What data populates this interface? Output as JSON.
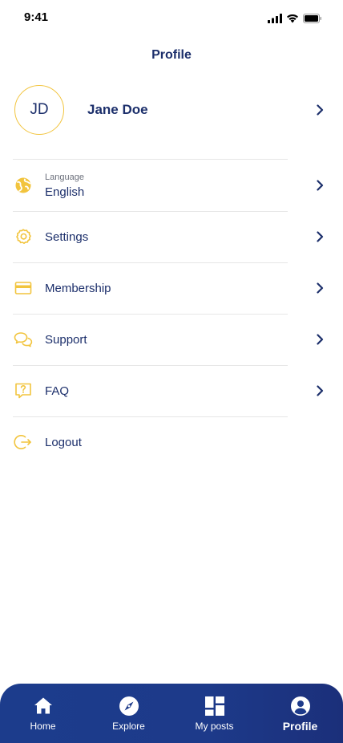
{
  "status_bar": {
    "time": "9:41",
    "icons": [
      "signal-icon",
      "wifi-icon",
      "battery-icon"
    ]
  },
  "header": {
    "title": "Profile"
  },
  "profile": {
    "initials": "JD",
    "name": "Jane Doe"
  },
  "menu": {
    "language": {
      "caption": "Language",
      "label": "English",
      "icon": "globe-icon"
    },
    "settings": {
      "label": "Settings",
      "icon": "gear-icon"
    },
    "membership": {
      "label": "Membership",
      "icon": "card-icon"
    },
    "support": {
      "label": "Support",
      "icon": "chat-bubbles-icon"
    },
    "faq": {
      "label": "FAQ",
      "icon": "question-message-icon"
    },
    "logout": {
      "label": "Logout",
      "icon": "logout-icon"
    }
  },
  "bottom_nav": {
    "home": {
      "label": "Home",
      "icon": "home-icon"
    },
    "explore": {
      "label": "Explore",
      "icon": "compass-icon"
    },
    "my_posts": {
      "label": "My posts",
      "icon": "grid-icon"
    },
    "profile": {
      "label": "Profile",
      "icon": "user-circle-icon",
      "active": true
    }
  },
  "colors": {
    "primary": "#1c2f6b",
    "accent": "#f2c43d",
    "nav_background": "#1d3a8a",
    "divider": "#e6e6e6"
  }
}
